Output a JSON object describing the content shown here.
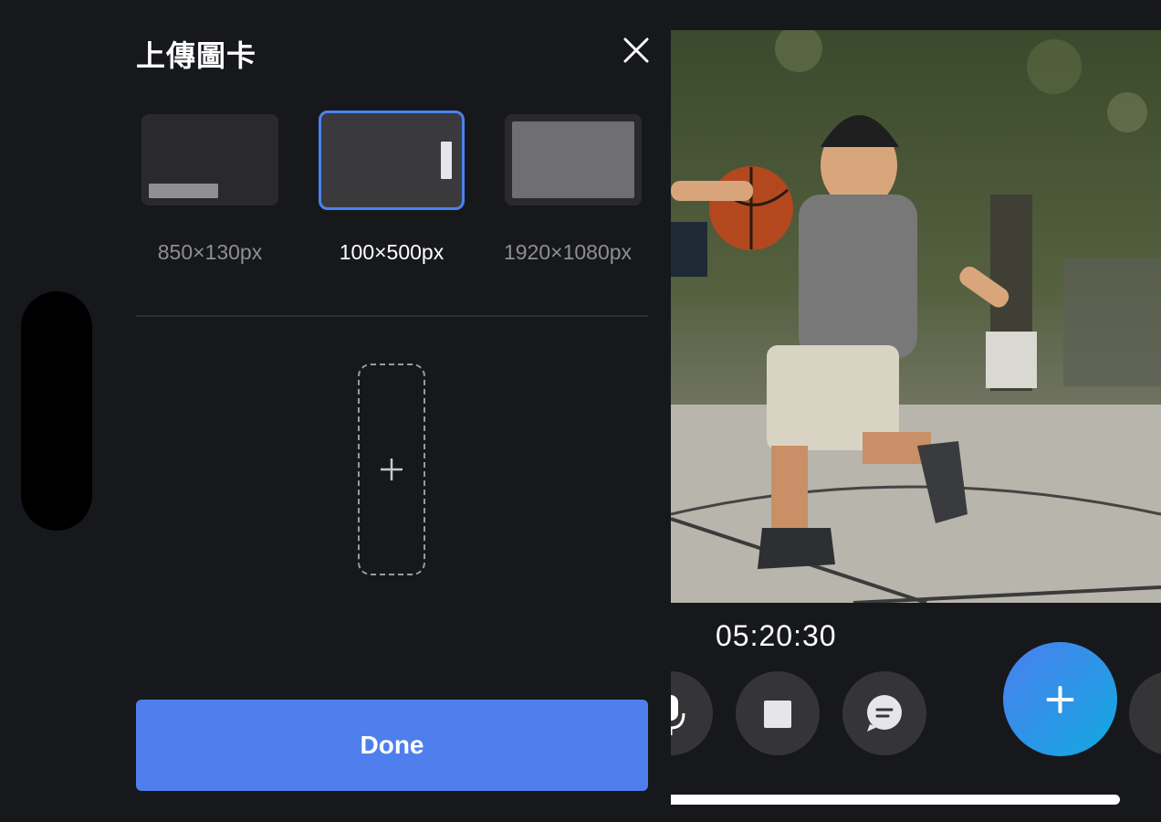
{
  "panel": {
    "title": "上傳圖卡",
    "close_icon": "close-icon",
    "size_options": [
      {
        "label": "850×130px",
        "selected": false
      },
      {
        "label": "100×500px",
        "selected": true
      },
      {
        "label": "1920×1080px",
        "selected": false
      }
    ],
    "upload_icon": "plus-icon",
    "done_label": "Done"
  },
  "player": {
    "timer": "05:20:30",
    "controls": [
      "microphone-icon",
      "stop-icon",
      "chat-icon",
      "plus-icon"
    ]
  },
  "colors": {
    "accent": "#4f7fec",
    "selected_border": "#4b82ee",
    "background": "#17181c"
  }
}
